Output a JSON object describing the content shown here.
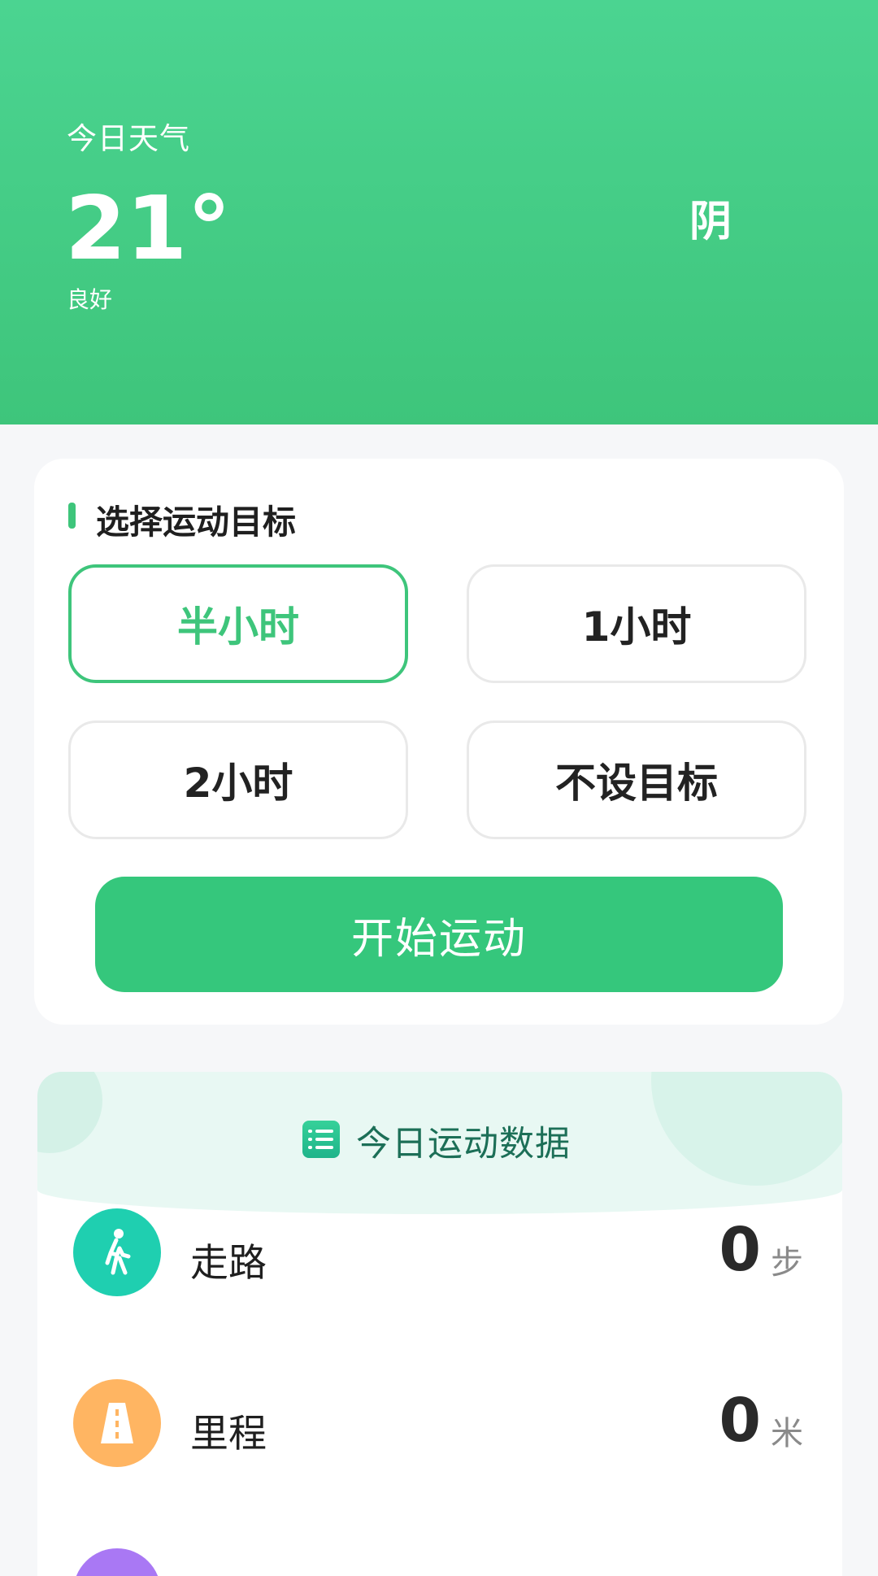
{
  "weather": {
    "label": "今日天气",
    "temperature": "21°",
    "quality": "良好",
    "condition": "阴"
  },
  "goal_section": {
    "title": "选择运动目标",
    "options": [
      {
        "label": "半小时",
        "selected": true
      },
      {
        "label": "1小时",
        "selected": false
      },
      {
        "label": "2小时",
        "selected": false
      },
      {
        "label": "不设目标",
        "selected": false
      }
    ],
    "start_button": "开始运动"
  },
  "data_section": {
    "title": "今日运动数据",
    "icon": "list-icon",
    "stats": [
      {
        "label": "走路",
        "value": "0",
        "unit": "步",
        "icon": "walking-person-icon",
        "color": "#1fcfb0"
      },
      {
        "label": "里程",
        "value": "0",
        "unit": "米",
        "icon": "road-icon",
        "color": "#ffb562"
      }
    ]
  },
  "colors": {
    "accent": "#3ec57b",
    "header_bg": "#4bd491"
  }
}
